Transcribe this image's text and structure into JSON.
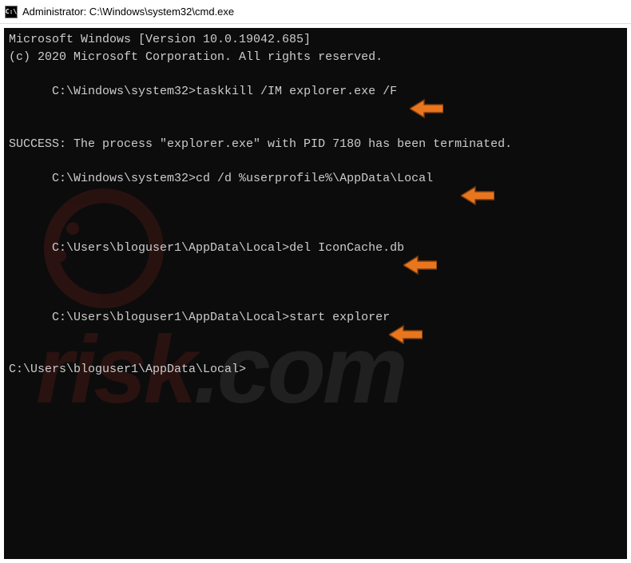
{
  "titlebar": {
    "icon_label": "C:\\",
    "title": "Administrator: C:\\Windows\\system32\\cmd.exe"
  },
  "terminal": {
    "lines": [
      "Microsoft Windows [Version 10.0.19042.685]",
      "(c) 2020 Microsoft Corporation. All rights reserved.",
      "",
      "C:\\Windows\\system32>taskkill /IM explorer.exe /F",
      "SUCCESS: The process \"explorer.exe\" with PID 7180 has been terminated.",
      "",
      "C:\\Windows\\system32>cd /d %userprofile%\\AppData\\Local",
      "",
      "C:\\Users\\bloguser1\\AppData\\Local>del IconCache.db",
      "",
      "",
      "",
      "C:\\Users\\bloguser1\\AppData\\Local>start explorer",
      "",
      "C:\\Users\\bloguser1\\AppData\\Local>"
    ]
  },
  "watermark": {
    "text_left": "risk",
    "text_right": ".com"
  },
  "annotations": {
    "arrow_fill": "#e8761f",
    "arrow_stroke": "#7a3c0a"
  }
}
